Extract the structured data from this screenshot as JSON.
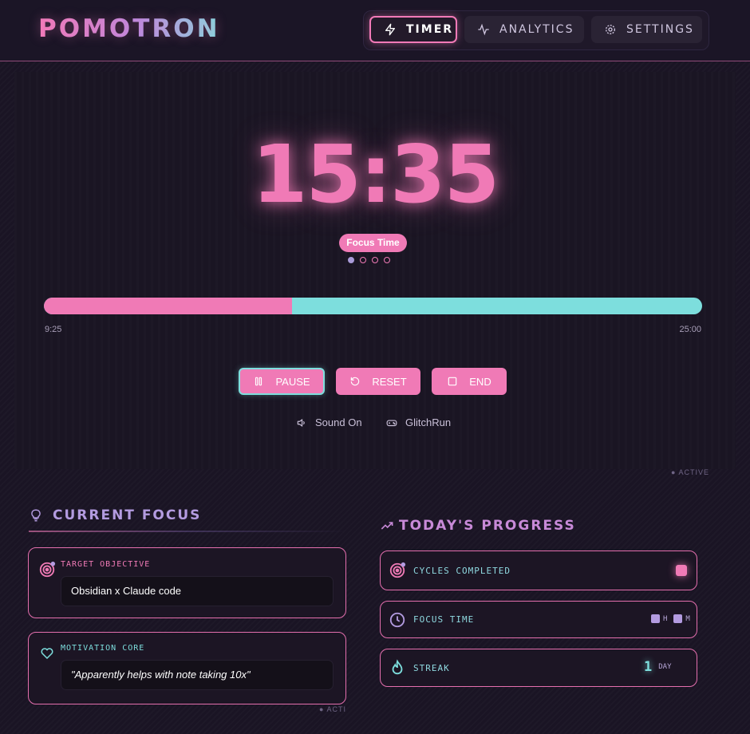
{
  "app": {
    "title": "POMOTRON"
  },
  "nav": {
    "timer": "TIMER",
    "analytics": "ANALYTICS",
    "settings": "SETTINGS",
    "active": "timer"
  },
  "timer": {
    "display": "15:35",
    "mode": "Focus Time",
    "cycle_dots": 4,
    "cycle_current": 1,
    "elapsed_label": "9:25",
    "total_label": "25:00",
    "progress_fraction": 0.377
  },
  "controls": {
    "pause": "PAUSE",
    "reset": "RESET",
    "end": "END"
  },
  "toggles": {
    "sound": "Sound On",
    "game": "GlitchRun"
  },
  "status": {
    "active": "ACTIVE",
    "acti": "ACTI"
  },
  "focus": {
    "title": "CURRENT FOCUS",
    "objective_label": "TARGET OBJECTIVE",
    "objective_value": "Obsidian x Claude code",
    "motivation_label": "MOTIVATION CORE",
    "motivation_value": "\"Apparently helps with note taking 10x\""
  },
  "progress": {
    "title": "TODAY'S PROGRESS",
    "cycles_label": "CYCLES COMPLETED",
    "focus_time_label": "FOCUS TIME",
    "focus_h": "H",
    "focus_m": "M",
    "streak_label": "STREAK",
    "streak_value": "1",
    "streak_unit": "DAY"
  },
  "colors": {
    "pink": "#f07ab6",
    "cyan": "#7ddedd",
    "lavender": "#b39be0",
    "bg": "#1a1424"
  }
}
